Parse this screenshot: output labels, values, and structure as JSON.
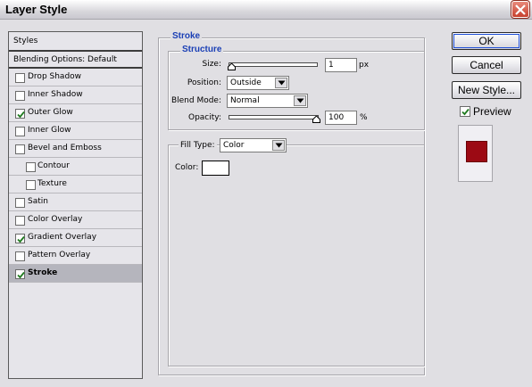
{
  "window": {
    "title": "Layer Style"
  },
  "styles_panel": {
    "header": "Styles",
    "blending_options": "Blending Options: Default",
    "items": [
      {
        "label": "Drop Shadow",
        "checked": false,
        "level": 0
      },
      {
        "label": "Inner Shadow",
        "checked": false,
        "level": 0
      },
      {
        "label": "Outer Glow",
        "checked": true,
        "level": 0
      },
      {
        "label": "Inner Glow",
        "checked": false,
        "level": 0
      },
      {
        "label": "Bevel and Emboss",
        "checked": false,
        "level": 0
      },
      {
        "label": "Contour",
        "checked": false,
        "level": 1
      },
      {
        "label": "Texture",
        "checked": false,
        "level": 1
      },
      {
        "label": "Satin",
        "checked": false,
        "level": 0
      },
      {
        "label": "Color Overlay",
        "checked": false,
        "level": 0
      },
      {
        "label": "Gradient Overlay",
        "checked": true,
        "level": 0
      },
      {
        "label": "Pattern Overlay",
        "checked": false,
        "level": 0
      },
      {
        "label": "Stroke",
        "checked": true,
        "level": 0,
        "selected": true
      }
    ]
  },
  "stroke": {
    "title": "Stroke",
    "structure_title": "Structure",
    "size_label": "Size:",
    "size_value": "1",
    "size_unit": "px",
    "position_label": "Position:",
    "position_value": "Outside",
    "blend_mode_label": "Blend Mode:",
    "blend_mode_value": "Normal",
    "opacity_label": "Opacity:",
    "opacity_value": "100",
    "opacity_unit": "%",
    "size_slider_fraction": 0.0,
    "opacity_slider_fraction": 1.0,
    "fill_type_label": "Fill Type:",
    "fill_type_value": "Color",
    "color_label": "Color:",
    "stroke_color": "#ffffff"
  },
  "buttons": {
    "ok": "OK",
    "cancel": "Cancel",
    "new_style": "New Style...",
    "preview_label": "Preview",
    "preview_checked": true
  },
  "preview": {
    "swatch_color": "#9c0a14"
  }
}
